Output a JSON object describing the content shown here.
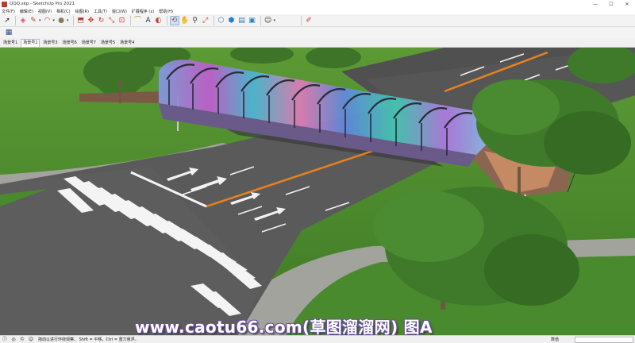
{
  "window": {
    "title": "QQQ.skp - SketchUp Pro 2021",
    "controls": {
      "minimize": "—",
      "maximize": "☐",
      "close": "✕"
    }
  },
  "menu": [
    "文件(F)",
    "编辑(E)",
    "视图(V)",
    "相机(C)",
    "绘图(R)",
    "工具(T)",
    "窗口(W)",
    "扩展程序 (x)",
    "帮助(H)"
  ],
  "toolbar": {
    "tools": [
      {
        "name": "select-icon",
        "glyph": "➚"
      },
      {
        "name": "eraser-icon",
        "glyph": "◈"
      },
      {
        "name": "pencil-icon",
        "glyph": "✎"
      },
      {
        "name": "arc-icon",
        "glyph": "◠"
      },
      {
        "name": "shape-icon",
        "glyph": "●"
      },
      {
        "name": "push-pull-icon",
        "glyph": "⬒"
      },
      {
        "name": "move-icon",
        "glyph": "✥"
      },
      {
        "name": "rotate-icon",
        "glyph": "↻"
      },
      {
        "name": "scale-icon",
        "glyph": "⤡"
      },
      {
        "name": "offset-icon",
        "glyph": "⊡"
      },
      {
        "name": "tape-measure-icon",
        "glyph": "⌒"
      },
      {
        "name": "text-icon",
        "glyph": "A"
      },
      {
        "name": "paint-bucket-icon",
        "glyph": "◐"
      },
      {
        "name": "orbit-icon",
        "glyph": "⟲"
      },
      {
        "name": "pan-icon",
        "glyph": "✋"
      },
      {
        "name": "zoom-icon",
        "glyph": "⚲"
      },
      {
        "name": "zoom-extents-icon",
        "glyph": "⤢"
      },
      {
        "name": "warehouse-icon",
        "glyph": "⬡"
      },
      {
        "name": "extension-warehouse-icon",
        "glyph": "⬢"
      },
      {
        "name": "send-layout-icon",
        "glyph": "▤"
      },
      {
        "name": "extension-manager-icon",
        "glyph": "▣"
      },
      {
        "name": "account-icon",
        "glyph": "☺"
      },
      {
        "name": "model-info-icon",
        "glyph": "✐"
      }
    ],
    "second_row_tool": {
      "name": "layers-icon",
      "glyph": "▦"
    }
  },
  "scenes": [
    "场景号1",
    "场景号2",
    "场景号3",
    "场景号6",
    "场景号7",
    "场景号5",
    "场景号4"
  ],
  "active_scene_index": 1,
  "watermark": "www.caotu66.com(草图溜溜网) 图A",
  "status": {
    "text": "拖动以进行环绕观察。 Shift = 平移。Ctrl = 重力悬浮。",
    "measurements_label": "数值",
    "measurements_value": ""
  },
  "colors": {
    "grass": "#4f8f2f",
    "road": "#5a5a5a",
    "road_dark": "#3b3b3b",
    "center_line": "#e8821e",
    "sidewalk": "#9a9a96",
    "tree": "#3f7a2a",
    "bridge_glass": [
      "#7f6bd8",
      "#c25cd0",
      "#4bb6d8",
      "#e07ab8",
      "#5f89e0",
      "#43c9b4"
    ]
  }
}
